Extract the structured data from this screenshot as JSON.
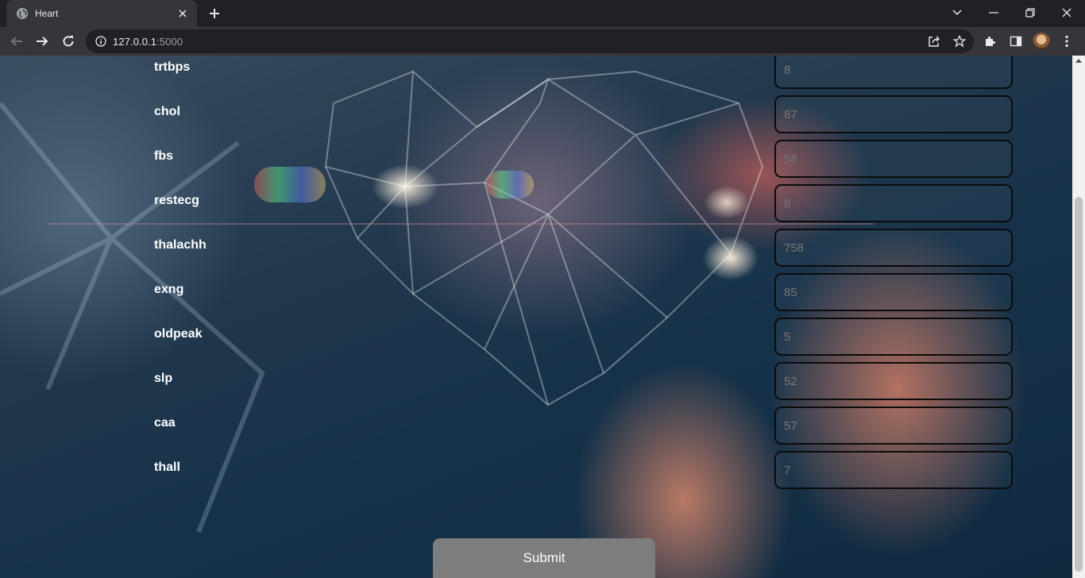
{
  "browser": {
    "tab_title": "Heart",
    "url_host": "127.0.0.1",
    "url_port": ":5000"
  },
  "form": {
    "fields": [
      {
        "label": "trtbps",
        "value": "8"
      },
      {
        "label": "chol",
        "value": "87"
      },
      {
        "label": "fbs",
        "value": "58"
      },
      {
        "label": "restecg",
        "value": "8"
      },
      {
        "label": "thalachh",
        "value": "758"
      },
      {
        "label": "exng",
        "value": "85"
      },
      {
        "label": "oldpeak",
        "value": "5"
      },
      {
        "label": "slp",
        "value": "52"
      },
      {
        "label": "caa",
        "value": "57"
      },
      {
        "label": "thall",
        "value": "7"
      }
    ],
    "submit_label": "Submit"
  }
}
